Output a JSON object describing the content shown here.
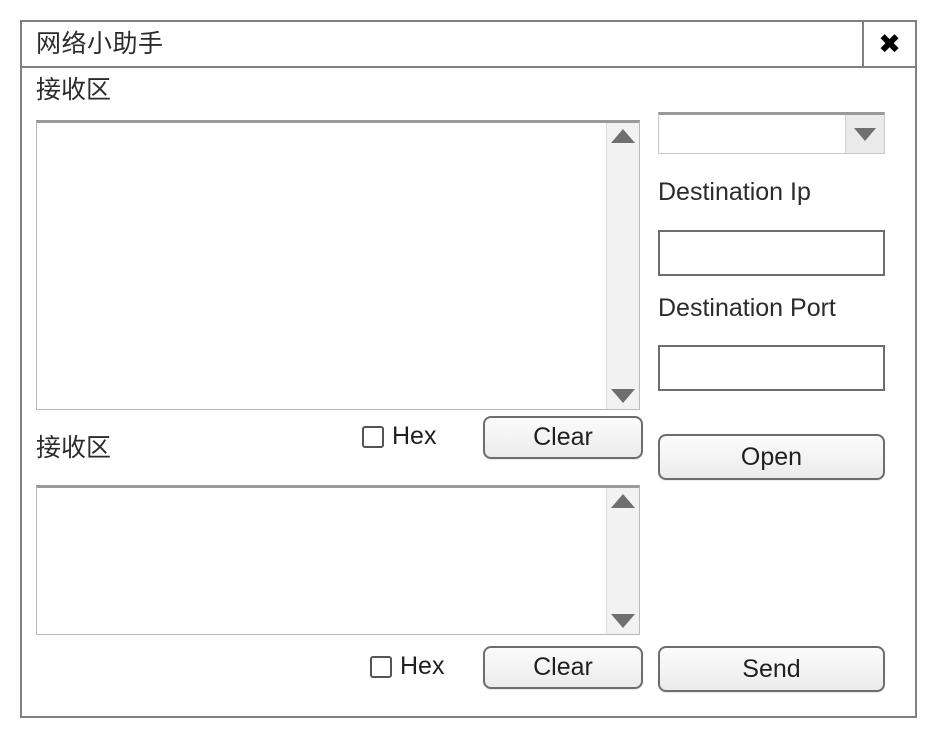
{
  "window": {
    "title": "网络小助手",
    "close_label": "✖"
  },
  "receive_section": {
    "label": "接收区",
    "content": "",
    "hex_label": "Hex",
    "hex_checked": false,
    "clear_label": "Clear"
  },
  "send_section": {
    "label": "接收区",
    "content": "",
    "hex_label": "Hex",
    "hex_checked": false,
    "clear_label": "Clear"
  },
  "right_panel": {
    "protocol_select": {
      "value": "",
      "options": []
    },
    "destination_ip": {
      "label": "Destination Ip",
      "value": ""
    },
    "destination_port": {
      "label": "Destination Port",
      "value": ""
    },
    "open_label": "Open",
    "send_label": "Send"
  },
  "scrollbars": {
    "up_icon": "triangle-up-icon",
    "down_icon": "triangle-down-icon"
  },
  "colors": {
    "frame_border": "#808080",
    "button_border": "#6d6d6d",
    "text": "#2b2b2b",
    "scroll_arrow": "#6f6f6f",
    "background": "#ffffff"
  }
}
